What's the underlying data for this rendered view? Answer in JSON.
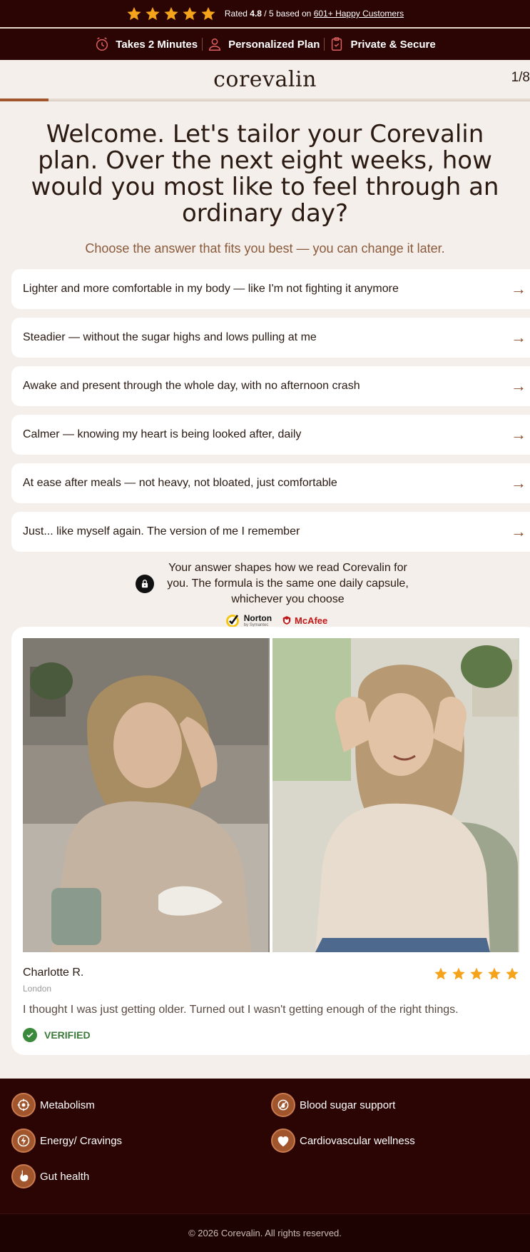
{
  "topbar": {
    "rated_prefix": "Rated",
    "rating": "4.8",
    "rating_suffix": "/ 5 based on",
    "customers_link": "601+ Happy Customers",
    "star_count": 5,
    "star_color": "#f5a31a"
  },
  "features": [
    {
      "icon": "clock-icon",
      "label": "Takes 2 Minutes"
    },
    {
      "icon": "person-icon",
      "label": "Personalized Plan"
    },
    {
      "icon": "secure-clipboard-icon",
      "label": "Private & Secure"
    }
  ],
  "header": {
    "logo": "corevalin",
    "step": "1/8",
    "progress": 0.125
  },
  "quiz": {
    "question": "Welcome. Let's tailor your Corevalin plan. Over the next eight weeks, how would you most like to feel through an ordinary day?",
    "subtitle": "Choose the answer that fits you best — you can change it later.",
    "options": [
      "Lighter and more comfortable in my body — like I'm not fighting it anymore",
      "Steadier — without the sugar highs and lows pulling at me",
      "Awake and present through the whole day, with no afternoon crash",
      "Calmer — knowing my heart is being looked after, daily",
      "At ease after meals — not heavy, not bloated, just comfortable",
      "Just... like myself again. The version of me I remember"
    ]
  },
  "secure_note": {
    "text": "Your answer shapes how we read Corevalin for you. The formula is the same one daily capsule, whichever you choose",
    "norton": "Norton",
    "norton_sub": "by Symantec",
    "mcafee": "McAfee"
  },
  "testimonial": {
    "name": "Charlotte R.",
    "location": "London",
    "rating": 5,
    "quote": "I thought I was just getting older. Turned out I wasn't getting enough of the right things.",
    "verified": "VERIFIED"
  },
  "benefits": [
    {
      "icon": "metabolism-icon",
      "label": "Metabolism"
    },
    {
      "icon": "blood-sugar-icon",
      "label": "Blood sugar support"
    },
    {
      "icon": "energy-icon",
      "label": "Energy/ Cravings"
    },
    {
      "icon": "heart-icon",
      "label": "Cardiovascular wellness"
    },
    {
      "icon": "stomach-icon",
      "label": "Gut health"
    }
  ],
  "footer": {
    "copyright": "© 2026 Corevalin. All rights reserved."
  },
  "colors": {
    "brand_dark": "#2b0404",
    "accent": "#a0552d",
    "star": "#f5a31a",
    "verified": "#3b8a3b"
  }
}
